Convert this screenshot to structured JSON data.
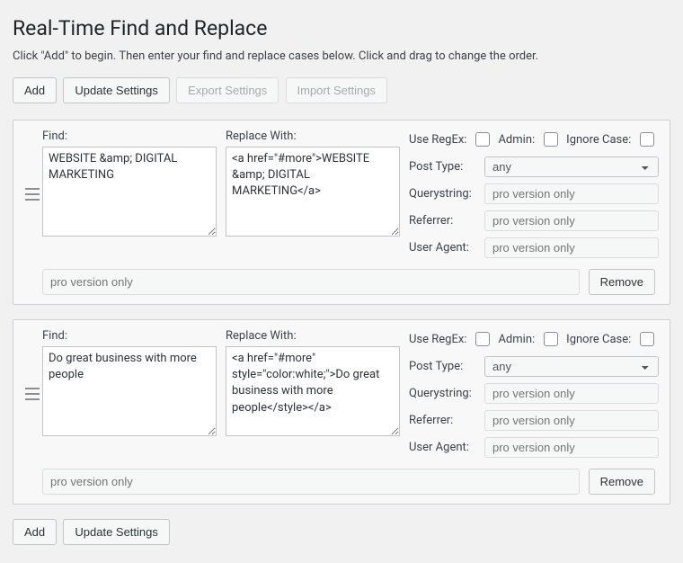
{
  "page_title": "Real-Time Find and Replace",
  "intro": "Click \"Add\" to begin. Then enter your find and replace cases below. Click and drag to change the order.",
  "buttons": {
    "add": "Add",
    "update": "Update Settings",
    "export": "Export Settings",
    "import": "Import Settings",
    "remove": "Remove"
  },
  "labels": {
    "find": "Find:",
    "replace": "Replace With:",
    "use_regex": "Use RegEx:",
    "admin": "Admin:",
    "ignore_case": "Ignore Case:",
    "post_type": "Post Type:",
    "querystring": "Querystring:",
    "referrer": "Referrer:",
    "user_agent": "User Agent:"
  },
  "placeholders": {
    "pro": "pro version only",
    "any": "any"
  },
  "rules": [
    {
      "find": "WEBSITE &amp; DIGITAL MARKETING",
      "replace": "<a href=\"#more\">WEBSITE &amp; DIGITAL MARKETING</a>"
    },
    {
      "find": "Do great business with more people",
      "replace": "<a href=\"#more\" style=\"color:white;\">Do great business with more people</style></a>"
    }
  ]
}
